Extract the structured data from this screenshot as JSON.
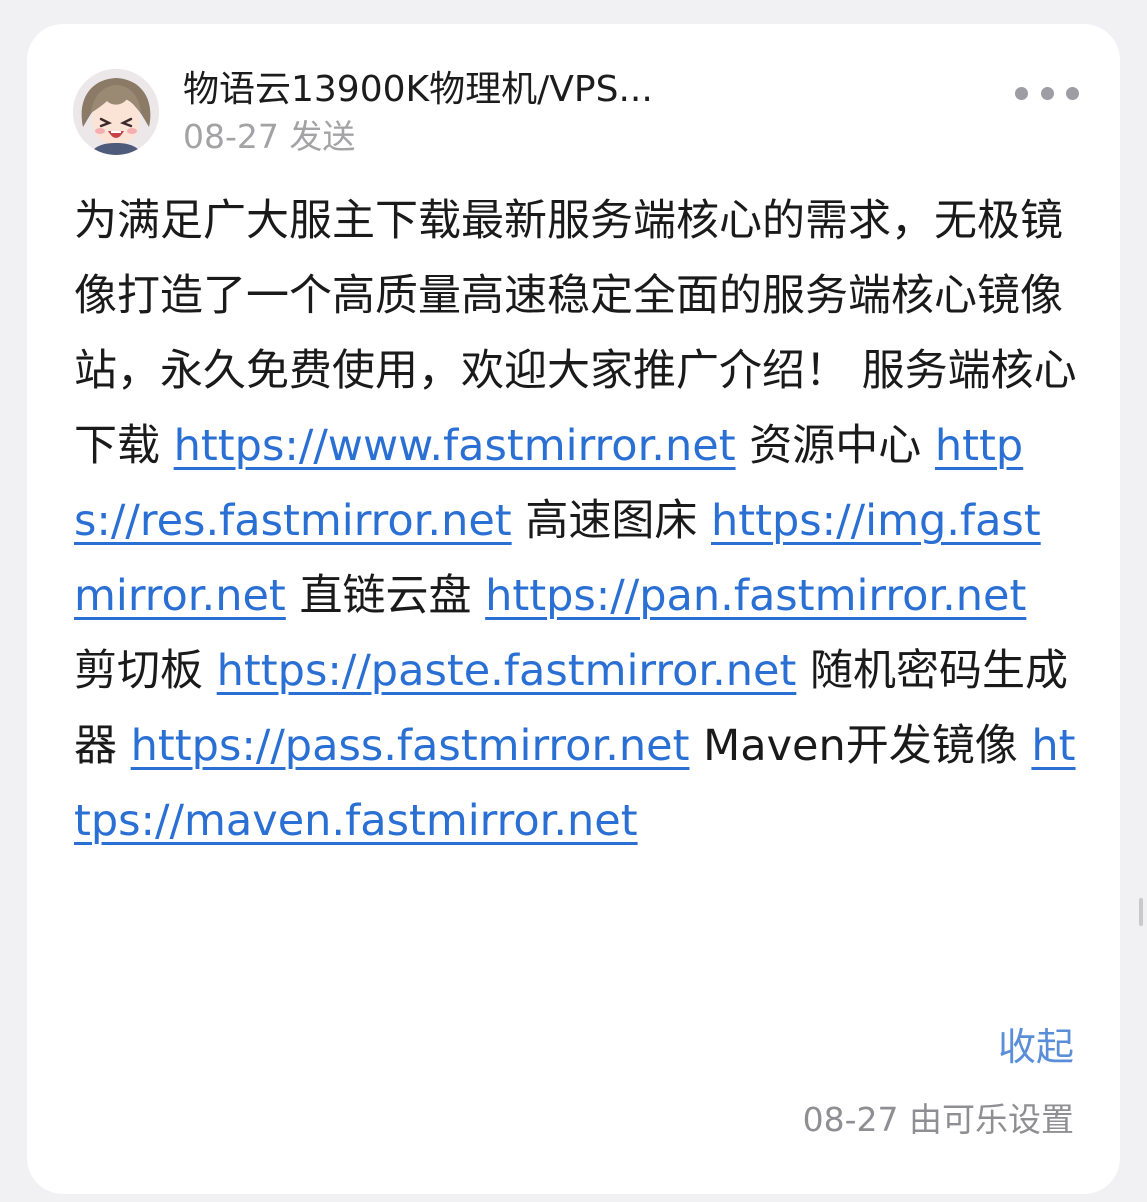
{
  "post": {
    "sender_name": "物语云13900K物理机/VPS...",
    "sent_time": "08-27 发送",
    "more_icon": "more-horizontal-icon",
    "body": [
      {
        "type": "text",
        "text": "为满足广大服主下载最新服务端核心的需求，无极镜像打造了一个高质量高速稳定全面的服务端核心镜像站，永久免费使用，欢迎大家推广介绍！ 服务端核心下载 "
      },
      {
        "type": "link",
        "text": "https://www.fastmirror.net"
      },
      {
        "type": "text",
        "text": " 资源中心 "
      },
      {
        "type": "link",
        "text": "https://res.fastmirror.net"
      },
      {
        "type": "text",
        "text": " 高速图床 "
      },
      {
        "type": "link",
        "text": "https://img.fastmirror.net"
      },
      {
        "type": "text",
        "text": " 直链云盘 "
      },
      {
        "type": "link",
        "text": "https://pan.fastmirror.net"
      },
      {
        "type": "text",
        "text": " 剪切板 "
      },
      {
        "type": "link",
        "text": "https://paste.fastmirror.net"
      },
      {
        "type": "text",
        "text": " 随机密码生成器 "
      },
      {
        "type": "link",
        "text": "https://pass.fastmirror.net"
      },
      {
        "type": "text",
        "text": " Maven开发镜像 "
      },
      {
        "type": "link",
        "text": "https://maven.fastmirror.net"
      }
    ],
    "collapse_label": "收起",
    "footer_meta": "08-27 由可乐设置"
  },
  "colors": {
    "link": "#2a6fd3",
    "collapse": "#5b8ed8",
    "meta": "#a3a3a6",
    "background": "#f1f1f3",
    "card": "#ffffff"
  }
}
